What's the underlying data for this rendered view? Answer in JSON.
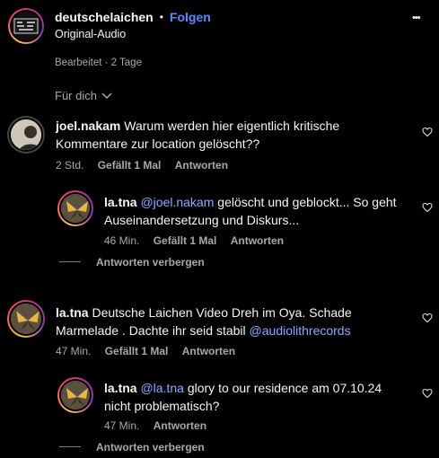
{
  "header": {
    "account": "deutschelaichen",
    "separator": "•",
    "follow_label": "Folgen",
    "audio": "Original-Audio",
    "more_label": "•••"
  },
  "post_meta": "Bearbeitet · 2 Tage",
  "sort": {
    "label": "Für dich"
  },
  "comments": [
    {
      "user": "joel.nakam",
      "text": "Warum werden hier eigentlich kritische Kommentare zur location gelöscht??",
      "time": "2 Std.",
      "likes": "Gefällt 1 Mal",
      "reply": "Antworten",
      "replies": [
        {
          "user": "la.tna",
          "mention": "@joel.nakam",
          "text": "gelöscht und geblockt... So geht Auseinandersetzung und Diskurs...",
          "time": "46 Min.",
          "likes": "Gefällt 1 Mal",
          "reply": "Antworten"
        }
      ],
      "hide_replies": "Antworten verbergen"
    },
    {
      "user": "la.tna",
      "text": "Deutsche Laichen Video Dreh im Oya. Schade Marmelade . Dachte ihr seid stabil",
      "mention": "@audiolithrecords",
      "time": "47 Min.",
      "likes": "Gefällt 1 Mal",
      "reply": "Antworten",
      "replies": [
        {
          "user": "la.tna",
          "mention": "@la.tna",
          "text": "glory to our residence am 07.10.24 nicht problematisch?",
          "time": "47 Min.",
          "reply": "Antworten"
        }
      ],
      "hide_replies": "Antworten verbergen"
    }
  ],
  "colors": {
    "background": "#000000",
    "link": "#8fa8ff",
    "follow": "#5a8bff",
    "muted": "#a8a8a8"
  }
}
